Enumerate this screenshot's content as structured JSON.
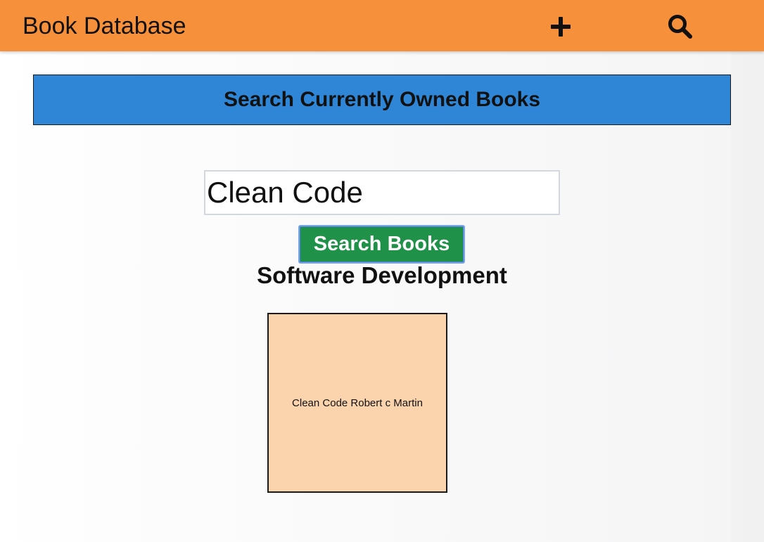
{
  "header": {
    "title": "Book Database",
    "add_icon": "plus-icon",
    "search_icon": "magnifier-icon"
  },
  "banner": {
    "title": "Search Currently Owned Books"
  },
  "search": {
    "value": "Clean Code",
    "button_label": "Search Books"
  },
  "results": {
    "category": "Software Development",
    "books": [
      {
        "label": "Clean Code Robert c Martin"
      }
    ]
  },
  "colors": {
    "header_bg": "#f6903a",
    "banner_bg": "#2f86d6",
    "button_bg": "#1f9148",
    "card_bg": "#fbd3ad"
  }
}
